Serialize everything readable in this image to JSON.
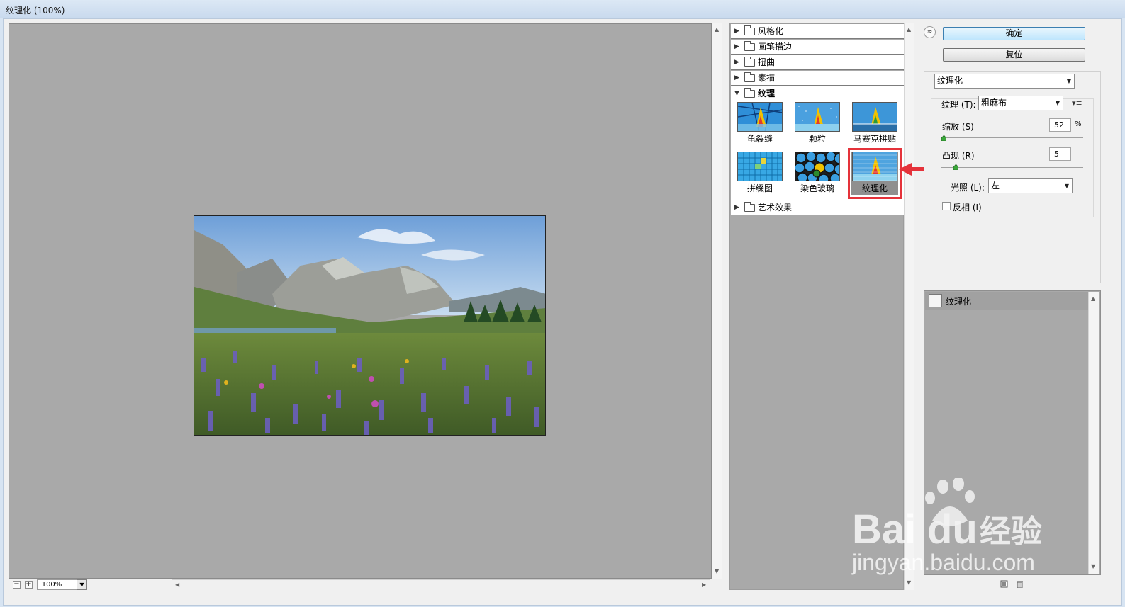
{
  "window": {
    "title": "纹理化 (100%)"
  },
  "preview": {
    "zoom_value": "100%",
    "zoom_out_symbol": "−",
    "zoom_in_symbol": "+",
    "dropdown_symbol": "▼"
  },
  "filter_gallery": {
    "categories": [
      {
        "label": "风格化",
        "expanded": false
      },
      {
        "label": "画笔描边",
        "expanded": false
      },
      {
        "label": "扭曲",
        "expanded": false
      },
      {
        "label": "素描",
        "expanded": false
      },
      {
        "label": "纹理",
        "expanded": true
      },
      {
        "label": "艺术效果",
        "expanded": false
      }
    ],
    "texture_filters": [
      {
        "label": "龟裂缝",
        "selected": false
      },
      {
        "label": "颗粒",
        "selected": false
      },
      {
        "label": "马赛克拼贴",
        "selected": false
      },
      {
        "label": "拼缀图",
        "selected": false
      },
      {
        "label": "染色玻璃",
        "selected": false
      },
      {
        "label": "纹理化",
        "selected": true
      }
    ],
    "highlight_color": "#e5323a"
  },
  "actions": {
    "ok_label": "确定",
    "reset_label": "复位",
    "collapse_symbol": "≈"
  },
  "settings": {
    "filter_select": "纹理化",
    "texture_label": "纹理 (T):",
    "texture_value": "粗麻布",
    "scaling_label": "缩放 (S)",
    "scaling_value": "52",
    "scaling_unit": "%",
    "scaling_fraction": 0.02,
    "relief_label": "凸现 (R)",
    "relief_value": "5",
    "relief_fraction": 0.1,
    "light_label": "光照 (L):",
    "light_value": "左",
    "invert_label": "反相 (I)",
    "invert_checked": false
  },
  "effect_layers": {
    "items": [
      {
        "label": "纹理化",
        "visible": false
      }
    ]
  },
  "watermark": {
    "logo": "Baidu 经验",
    "url": "jingyan.baidu.com"
  }
}
